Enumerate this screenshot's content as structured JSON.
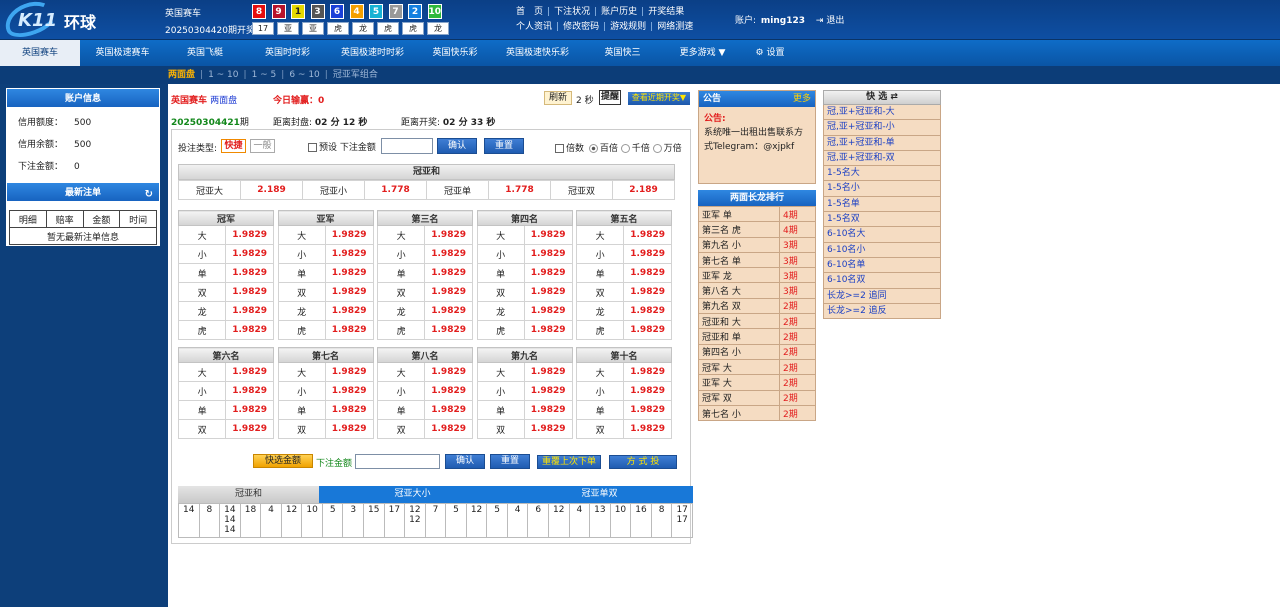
{
  "header": {
    "site_name": "环球",
    "logo_text": "K11",
    "game": "英国赛车",
    "period": "20250304420期开奖",
    "balls": [
      {
        "n": "8",
        "c": "#e60d0d"
      },
      {
        "n": "9",
        "c": "#b8132b"
      },
      {
        "n": "1",
        "c": "#e5d900"
      },
      {
        "n": "3",
        "c": "#555555"
      },
      {
        "n": "6",
        "c": "#1a40d8"
      },
      {
        "n": "4",
        "c": "#f5a000"
      },
      {
        "n": "5",
        "c": "#16b2d4"
      },
      {
        "n": "7",
        "c": "#999999"
      },
      {
        "n": "2",
        "c": "#1480e0"
      },
      {
        "n": "10",
        "c": "#2fb83b"
      }
    ],
    "tags": [
      "17",
      "亚",
      "亚",
      "虎",
      "龙",
      "虎",
      "虎",
      "龙"
    ],
    "links_row1": [
      "首　页",
      "下注状况",
      "账户历史",
      "开奖结果"
    ],
    "links_row2": [
      "个人资讯",
      "修改密码",
      "游戏规则",
      "网络测速"
    ],
    "account_label": "账户:",
    "account_name": "ming123",
    "logout": "退出"
  },
  "nav": {
    "items": [
      "英国赛车",
      "英国极速赛车",
      "英国飞艇",
      "英国时时彩",
      "英国极速时时彩",
      "英国快乐彩",
      "英国极速快乐彩",
      "英国快三",
      "更多游戏 ▼",
      "设置"
    ],
    "active": "英国赛车"
  },
  "subnav": {
    "items": [
      "两面盘",
      "1 ~ 10",
      "1 ~ 5",
      "6 ~ 10",
      "冠亚军组合"
    ]
  },
  "account_panel": {
    "title": "账户信息",
    "rows": [
      {
        "k": "信用额度：",
        "v": "500"
      },
      {
        "k": "信用余额：",
        "v": "500"
      },
      {
        "k": "下注金额：",
        "v": "0"
      }
    ]
  },
  "recent": {
    "title": "最新注单",
    "cols": [
      "明细",
      "赔率",
      "金额",
      "时间"
    ],
    "empty": "暂无最新注单信息"
  },
  "top": {
    "game": "英国赛车",
    "mode": "两面盘",
    "profit_label": "今日输赢：",
    "profit": "0",
    "refresh": "刷新",
    "seconds": "2 秒",
    "tip": "提醒",
    "view_recent": "查看近期开奖▼",
    "period": "20250304421",
    "period_suffix": "期",
    "close_label": "距离封盘:",
    "close_time": "02 分 12 秒",
    "open_label": "距离开奖:",
    "open_time": "02 分 33 秒"
  },
  "betbar": {
    "type_label": "投注类型:",
    "fast": "快捷",
    "normal": "一般",
    "preset_label": "预设",
    "amount_label": "下注金额",
    "confirm": "确认",
    "reset": "重置",
    "multiple": "倍数",
    "opt1": "百倍",
    "opt2": "千倍",
    "opt3": "万倍"
  },
  "guanya": {
    "title": "冠亚和",
    "cells": [
      [
        "冠亚大",
        "2.189"
      ],
      [
        "冠亚小",
        "1.778"
      ],
      [
        "冠亚单",
        "1.778"
      ],
      [
        "冠亚双",
        "2.189"
      ]
    ]
  },
  "positions1": [
    {
      "title": "冠军",
      "rows": [
        [
          "大",
          "1.9829"
        ],
        [
          "小",
          "1.9829"
        ],
        [
          "单",
          "1.9829"
        ],
        [
          "双",
          "1.9829"
        ],
        [
          "龙",
          "1.9829"
        ],
        [
          "虎",
          "1.9829"
        ]
      ]
    },
    {
      "title": "亚军",
      "rows": [
        [
          "大",
          "1.9829"
        ],
        [
          "小",
          "1.9829"
        ],
        [
          "单",
          "1.9829"
        ],
        [
          "双",
          "1.9829"
        ],
        [
          "龙",
          "1.9829"
        ],
        [
          "虎",
          "1.9829"
        ]
      ]
    },
    {
      "title": "第三名",
      "rows": [
        [
          "大",
          "1.9829"
        ],
        [
          "小",
          "1.9829"
        ],
        [
          "单",
          "1.9829"
        ],
        [
          "双",
          "1.9829"
        ],
        [
          "龙",
          "1.9829"
        ],
        [
          "虎",
          "1.9829"
        ]
      ]
    },
    {
      "title": "第四名",
      "rows": [
        [
          "大",
          "1.9829"
        ],
        [
          "小",
          "1.9829"
        ],
        [
          "单",
          "1.9829"
        ],
        [
          "双",
          "1.9829"
        ],
        [
          "龙",
          "1.9829"
        ],
        [
          "虎",
          "1.9829"
        ]
      ]
    },
    {
      "title": "第五名",
      "rows": [
        [
          "大",
          "1.9829"
        ],
        [
          "小",
          "1.9829"
        ],
        [
          "单",
          "1.9829"
        ],
        [
          "双",
          "1.9829"
        ],
        [
          "龙",
          "1.9829"
        ],
        [
          "虎",
          "1.9829"
        ]
      ]
    }
  ],
  "positions2": [
    {
      "title": "第六名",
      "rows": [
        [
          "大",
          "1.9829"
        ],
        [
          "小",
          "1.9829"
        ],
        [
          "单",
          "1.9829"
        ],
        [
          "双",
          "1.9829"
        ]
      ]
    },
    {
      "title": "第七名",
      "rows": [
        [
          "大",
          "1.9829"
        ],
        [
          "小",
          "1.9829"
        ],
        [
          "单",
          "1.9829"
        ],
        [
          "双",
          "1.9829"
        ]
      ]
    },
    {
      "title": "第八名",
      "rows": [
        [
          "大",
          "1.9829"
        ],
        [
          "小",
          "1.9829"
        ],
        [
          "单",
          "1.9829"
        ],
        [
          "双",
          "1.9829"
        ]
      ]
    },
    {
      "title": "第九名",
      "rows": [
        [
          "大",
          "1.9829"
        ],
        [
          "小",
          "1.9829"
        ],
        [
          "单",
          "1.9829"
        ],
        [
          "双",
          "1.9829"
        ]
      ]
    },
    {
      "title": "第十名",
      "rows": [
        [
          "大",
          "1.9829"
        ],
        [
          "小",
          "1.9829"
        ],
        [
          "单",
          "1.9829"
        ],
        [
          "双",
          "1.9829"
        ]
      ]
    }
  ],
  "bottombar": {
    "quick_amount": "快选金额",
    "amount_label": "下注金额",
    "confirm": "确认",
    "reset": "重置",
    "repeat": "重覆上次下单",
    "mode": "方 式 投"
  },
  "trend": {
    "tabs": [
      "冠亚和",
      "冠亚大小",
      "冠亚单双"
    ],
    "cols": [
      [
        "14"
      ],
      [
        "8"
      ],
      [
        "14",
        "14",
        "14"
      ],
      [
        "18"
      ],
      [
        "4"
      ],
      [
        "12"
      ],
      [
        "10"
      ],
      [
        "5"
      ],
      [
        "3"
      ],
      [
        "15"
      ],
      [
        "17"
      ],
      [
        "12",
        "12"
      ],
      [
        "7"
      ],
      [
        "5"
      ],
      [
        "12"
      ],
      [
        "5"
      ],
      [
        "4"
      ],
      [
        "6"
      ],
      [
        "12"
      ],
      [
        "4"
      ],
      [
        "13"
      ],
      [
        "10"
      ],
      [
        "16"
      ],
      [
        "8"
      ],
      [
        "17",
        "17"
      ]
    ]
  },
  "notice": {
    "title": "公告",
    "more": "更多",
    "label": "公告:",
    "text": "系统唯一出租出售联系方式Telegram：@xjpkf"
  },
  "streak": {
    "title": "两面长龙排行",
    "rows": [
      [
        "亚军 单",
        "4期"
      ],
      [
        "第三名 虎",
        "4期"
      ],
      [
        "第九名 小",
        "3期"
      ],
      [
        "第七名 单",
        "3期"
      ],
      [
        "亚军 龙",
        "3期"
      ],
      [
        "第八名 大",
        "3期"
      ],
      [
        "第九名 双",
        "2期"
      ],
      [
        "冠亚和 大",
        "2期"
      ],
      [
        "冠亚和 单",
        "2期"
      ],
      [
        "第四名 小",
        "2期"
      ],
      [
        "冠军 大",
        "2期"
      ],
      [
        "亚军 大",
        "2期"
      ],
      [
        "冠军 双",
        "2期"
      ],
      [
        "第七名 小",
        "2期"
      ]
    ]
  },
  "quick": {
    "title": "快 选",
    "items": [
      "冠,亚+冠亚和-大",
      "冠,亚+冠亚和-小",
      "冠,亚+冠亚和-单",
      "冠,亚+冠亚和-双",
      "1-5名大",
      "1-5名小",
      "1-5名单",
      "1-5名双",
      "6-10名大",
      "6-10名小",
      "6-10名单",
      "6-10名双",
      "长龙>=2 追同",
      "长龙>=2 追反"
    ]
  }
}
